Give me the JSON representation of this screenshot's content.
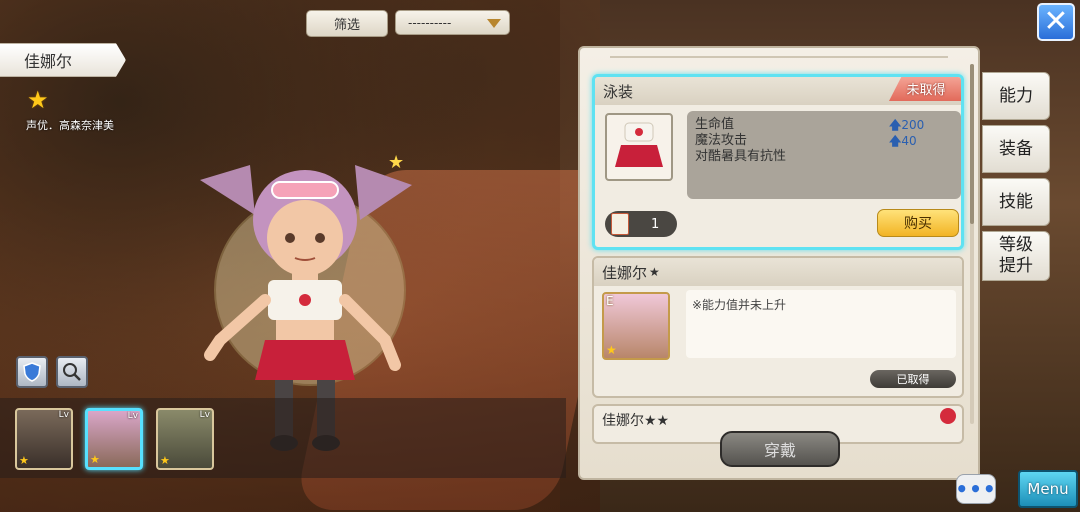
{
  "top_bar": {
    "filter_label": "筛选",
    "filter_select_value": "----------",
    "close_icon": "x-icon"
  },
  "character": {
    "name": "佳娜尔",
    "voice_actor": "声优．高森奈津美",
    "rarity_stars": 1
  },
  "roster": [
    {
      "level_label": "Lv",
      "stars": 1,
      "selected": false
    },
    {
      "level_label": "Lv",
      "stars": 1,
      "selected": true
    },
    {
      "level_label": "Lv",
      "stars": 1,
      "selected": false
    }
  ],
  "costume_card": {
    "title": "泳装",
    "ribbon": "未取得",
    "stats": [
      {
        "label": "生命值",
        "value": "200"
      },
      {
        "label": "魔法攻击",
        "value": "40"
      },
      {
        "label": "对酷暑具有抗性",
        "value": ""
      }
    ],
    "ticket_count": "1",
    "buy_label": "购买"
  },
  "default_card": {
    "title": "佳娜尔",
    "title_star": "★",
    "grade": "E",
    "note": "※能力值并未上升",
    "status_label": "已取得"
  },
  "partial_card": {
    "title": "佳娜尔★★"
  },
  "wear_button": "穿戴",
  "side_tabs": [
    "能力",
    "装备",
    "技能",
    "等级\n提升"
  ],
  "chat_label": "•••",
  "menu_label": "Menu",
  "colors": {
    "active_border": "#5fe2f2",
    "ribbon": "#e26a5a",
    "buy_button": "#f2b424",
    "stat_value": "#2a5fb0"
  }
}
